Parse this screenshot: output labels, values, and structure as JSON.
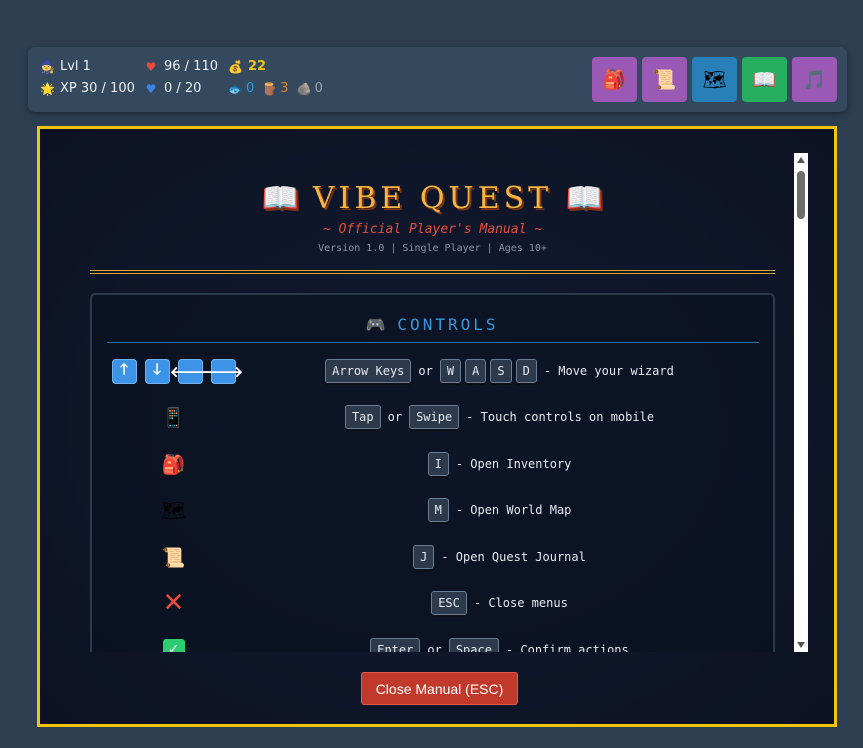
{
  "hud": {
    "level": "Lvl 1",
    "xp": "XP 30 / 100",
    "health": "96 / 110",
    "mana": "0 / 20",
    "gold": "22",
    "fish": "0",
    "wood": "3",
    "stone": "0",
    "icons": {
      "level": "wizard-icon",
      "xp": "sun-icon",
      "health": "heart-icon",
      "mana": "blue-heart-icon",
      "gold": "money-bag-icon",
      "fish": "fish-icon",
      "wood": "wood-log-icon",
      "stone": "rock-icon"
    },
    "colors": {
      "gold": "#f1c40f",
      "fish": "#3498db",
      "wood": "#e67e22",
      "stone": "#95a5a6"
    },
    "buttons": [
      {
        "name": "inventory",
        "icon": "backpack-icon",
        "color": "#9b59b6"
      },
      {
        "name": "quest-journal",
        "icon": "scroll-icon",
        "color": "#9b59b6"
      },
      {
        "name": "world-map",
        "icon": "map-icon",
        "color": "#2980b9"
      },
      {
        "name": "manual",
        "icon": "open-book-icon",
        "color": "#27ae60"
      },
      {
        "name": "music",
        "icon": "music-note-icon",
        "color": "#9b59b6"
      }
    ]
  },
  "manual": {
    "title": "VIBE QUEST",
    "subtitle": "~ Official Player's Manual ~",
    "version": "Version 1.0 | Single Player | Ages 10+",
    "controls_title": "CONTROLS",
    "rows": [
      {
        "icons": [
          "arrow-up-icon",
          "arrow-down-icon",
          "arrow-left-icon",
          "arrow-right-icon"
        ],
        "keys": [
          "Arrow Keys",
          "W",
          "A",
          "S",
          "D"
        ],
        "or": "or",
        "text": "- Move your wizard"
      },
      {
        "icons": [
          "mobile-phone-icon"
        ],
        "keys": [
          "Tap",
          "Swipe"
        ],
        "or": "or",
        "text": "- Touch controls on mobile"
      },
      {
        "icons": [
          "backpack-icon"
        ],
        "keys": [
          "I"
        ],
        "text": "- Open Inventory"
      },
      {
        "icons": [
          "map-icon"
        ],
        "keys": [
          "M"
        ],
        "text": "- Open World Map"
      },
      {
        "icons": [
          "scroll-icon"
        ],
        "keys": [
          "J"
        ],
        "text": "- Open Quest Journal"
      },
      {
        "icons": [
          "cross-mark-icon"
        ],
        "keys": [
          "ESC"
        ],
        "text": "- Close menus"
      },
      {
        "icons": [
          "check-mark-icon"
        ],
        "keys": [
          "Enter",
          "Space"
        ],
        "or": "or",
        "text": "- Confirm actions"
      }
    ],
    "close_button": "Close Manual (ESC)"
  }
}
